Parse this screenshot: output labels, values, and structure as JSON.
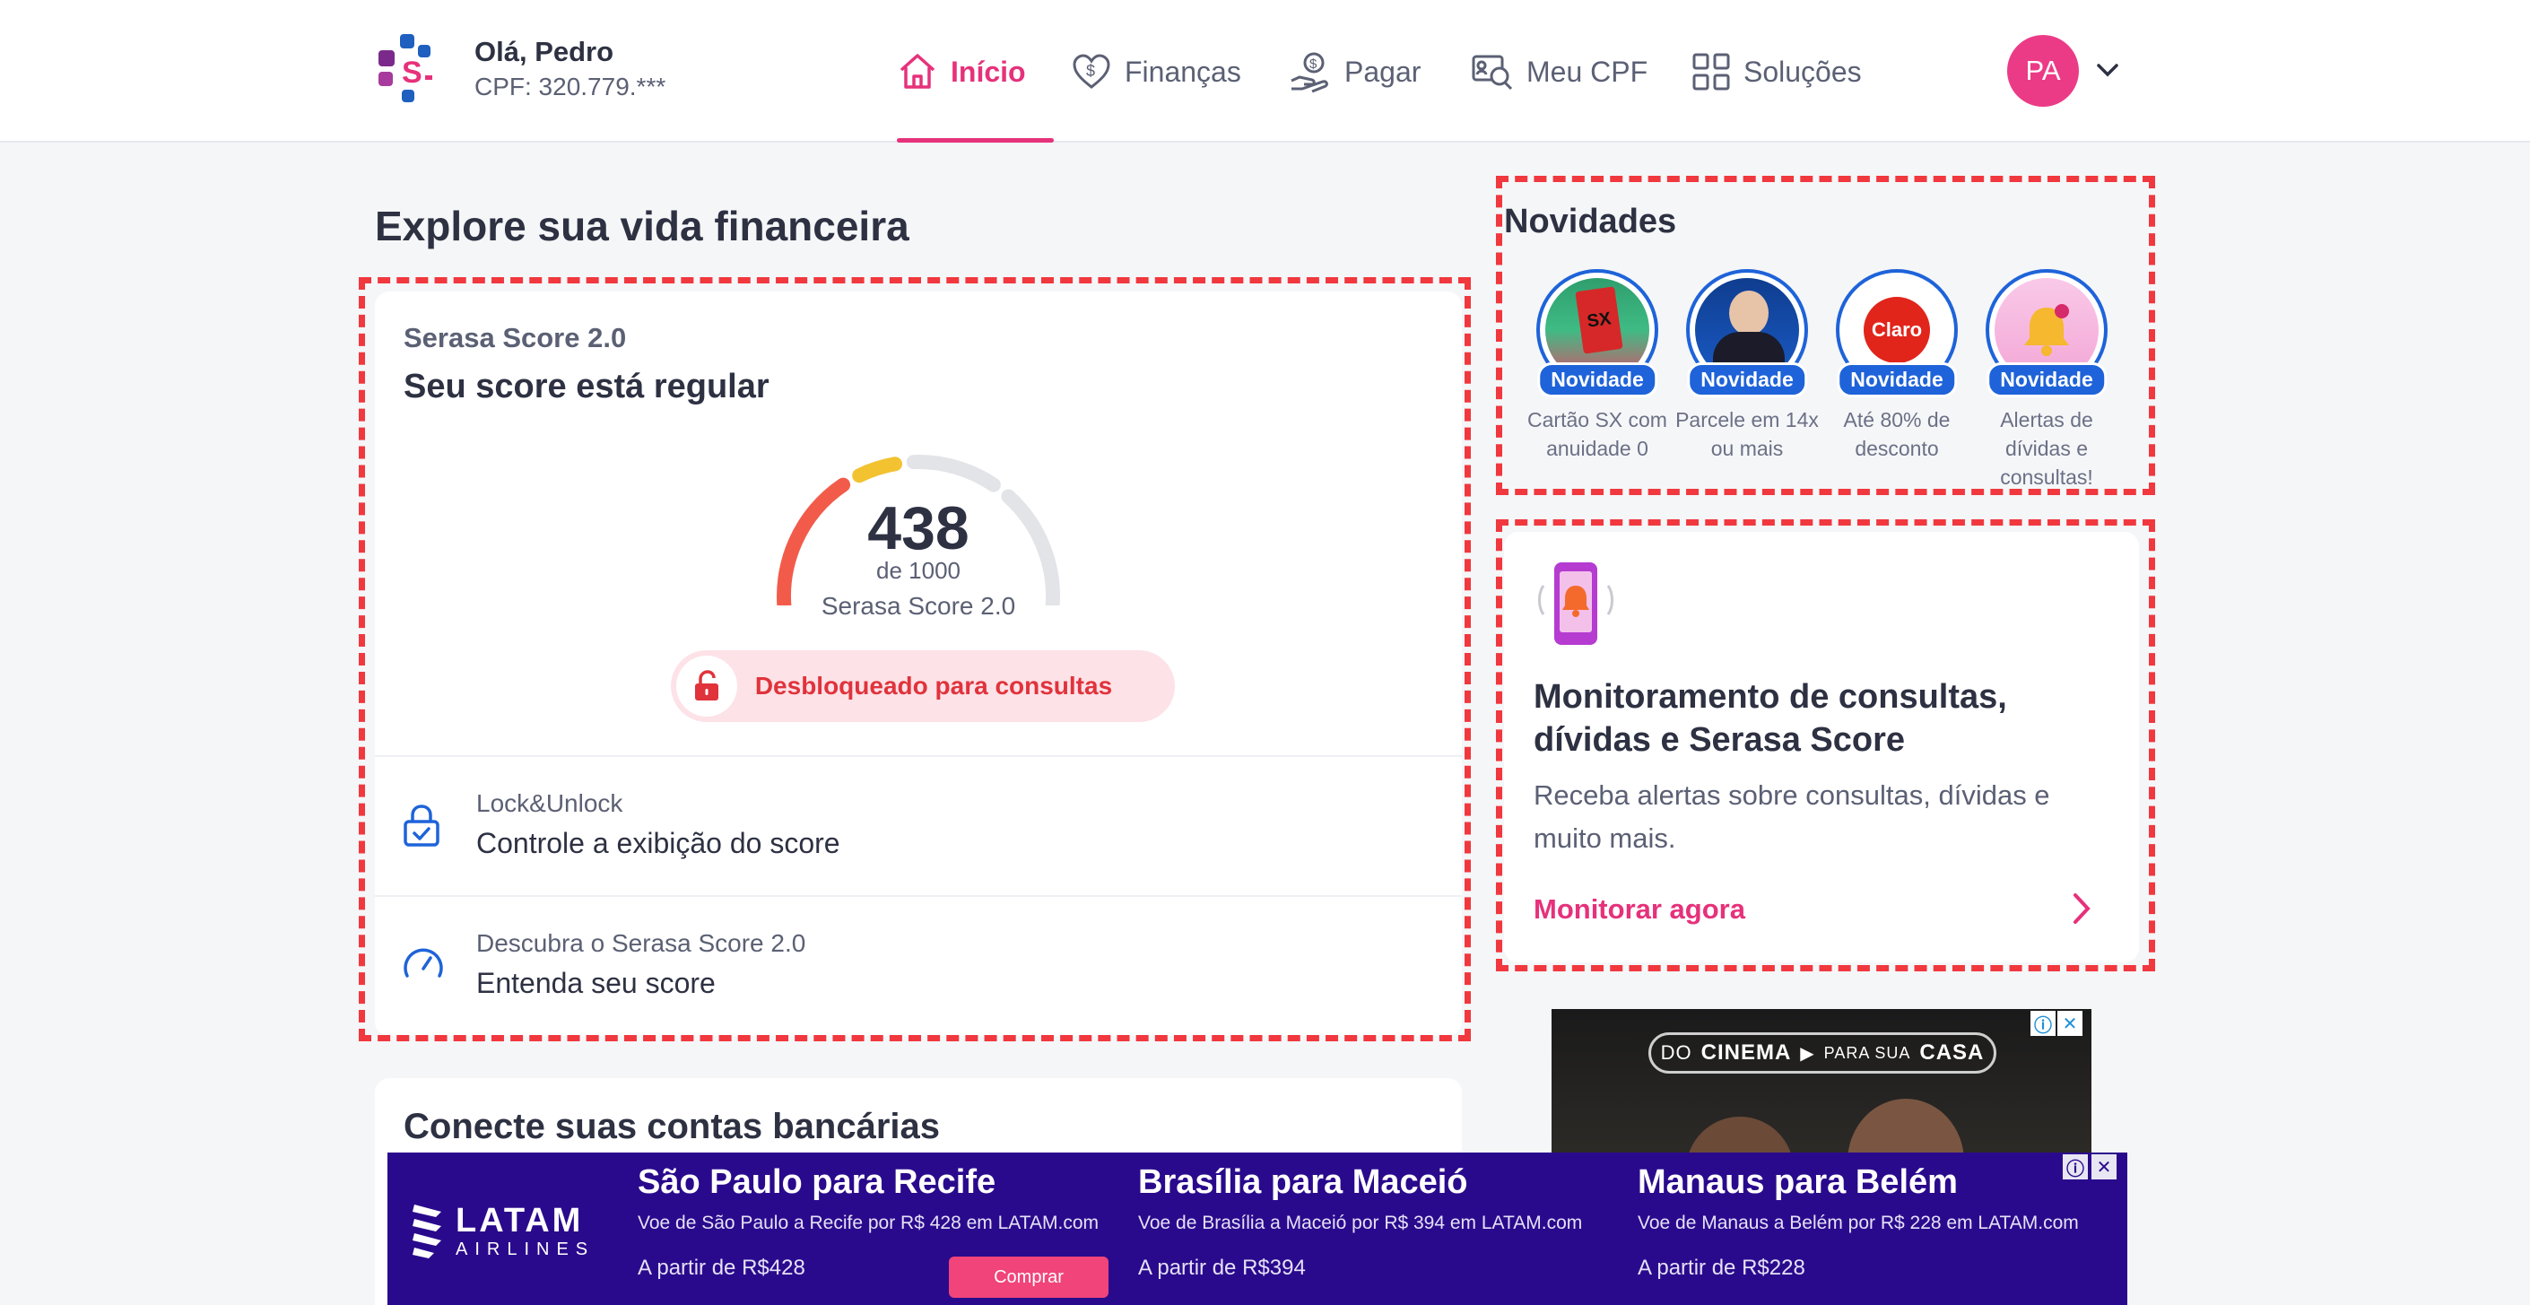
{
  "header": {
    "greeting": "Olá, Pedro",
    "cpf": "CPF: 320.779.***",
    "nav": [
      {
        "label": "Início",
        "icon": "home-icon",
        "active": true
      },
      {
        "label": "Finanças",
        "icon": "heart-dollar-icon"
      },
      {
        "label": "Pagar",
        "icon": "hand-coin-icon"
      },
      {
        "label": "Meu CPF",
        "icon": "id-search-icon"
      },
      {
        "label": "Soluções",
        "icon": "grid-icon"
      }
    ],
    "avatar_initials": "PA"
  },
  "main": {
    "title": "Explore sua vida financeira",
    "score_card": {
      "label": "Serasa Score 2.0",
      "title": "Seu score está regular",
      "score": "438",
      "score_max": "de 1000",
      "score_name": "Serasa Score 2.0",
      "score_value": 438,
      "score_range": [
        0,
        1000
      ],
      "status": "Desbloqueado para consultas",
      "rows": [
        {
          "sub": "Lock&Unlock",
          "main": "Controle a exibição do score",
          "icon": "lock-check-icon"
        },
        {
          "sub": "Descubra o Serasa Score 2.0",
          "main": "Entenda seu score",
          "icon": "gauge-icon"
        }
      ]
    },
    "bank_card": {
      "title": "Conecte suas contas bancárias"
    }
  },
  "news": {
    "title": "Novidades",
    "stories": [
      {
        "badge": "Novidade",
        "caption": "Cartão SX com anuidade 0"
      },
      {
        "badge": "Novidade",
        "caption": "Parcele em 14x ou mais"
      },
      {
        "badge": "Novidade",
        "caption": "Até 80% de desconto"
      },
      {
        "badge": "Novidade",
        "caption": "Alertas de dívidas e consultas!"
      }
    ],
    "story_logos": {
      "card": "SX",
      "claro": "Claro"
    }
  },
  "monitor": {
    "title": "Monitoramento de consultas, dívidas e Serasa Score",
    "desc": "Receba alertas sobre consultas, dívidas e muito mais.",
    "link": "Monitorar agora"
  },
  "ad_right": {
    "left": "DO",
    "main": "CINEMA",
    "right": "PARA SUA",
    "end": "CASA"
  },
  "bottom_ad": {
    "brand": "LATAM",
    "brand_sub": "AIRLINES",
    "buy_label": "Comprar",
    "routes": [
      {
        "title": "São Paulo para Recife",
        "sub": "Voe de São Paulo a Recife por R$ 428 em LATAM.com",
        "price": "A partir de R$428"
      },
      {
        "title": "Brasília para Maceió",
        "sub": "Voe de Brasília a Maceió por R$ 394 em LATAM.com",
        "price": "A partir de R$394"
      },
      {
        "title": "Manaus para Belém",
        "sub": "Voe de Manaus a Belém por R$ 228 em LATAM.com",
        "price": "A partir de R$228"
      }
    ]
  },
  "colors": {
    "brand_pink": "#e6317b",
    "annotation_red": "#f0383e",
    "story_blue": "#1e63d9",
    "ad_purple": "#2a0a8c"
  }
}
